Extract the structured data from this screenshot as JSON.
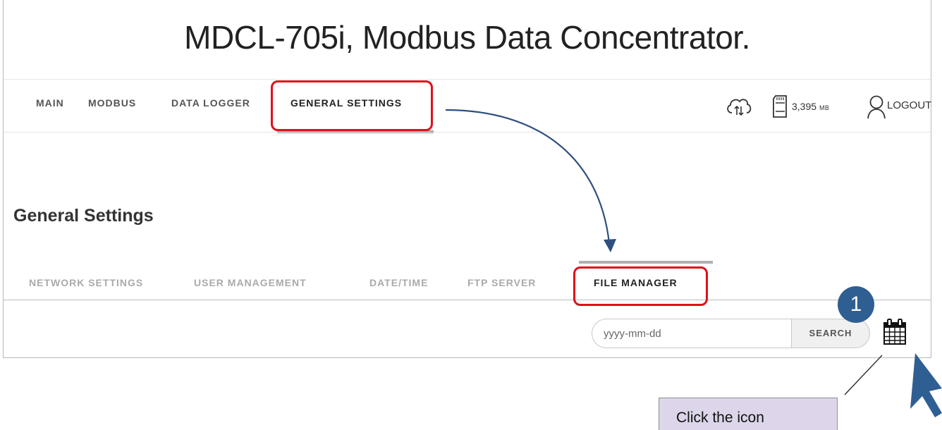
{
  "app": {
    "title": "MDCL-705i, Modbus Data Concentrator."
  },
  "nav": {
    "items": [
      {
        "label": "MAIN"
      },
      {
        "label": "MODBUS"
      },
      {
        "label": "DATA LOGGER"
      },
      {
        "label": "GENERAL SETTINGS",
        "active": true
      }
    ],
    "storage_value": "3,395",
    "storage_unit": "MB",
    "logout_label": "LOGOUT"
  },
  "page": {
    "heading": "General Settings",
    "tabs": [
      {
        "label": "NETWORK SETTINGS"
      },
      {
        "label": "USER MANAGEMENT"
      },
      {
        "label": "DATE/TIME"
      },
      {
        "label": "FTP SERVER"
      },
      {
        "label": "FILE MANAGER",
        "active": true
      }
    ],
    "search": {
      "placeholder": "yyyy-mm-dd",
      "value": "",
      "button_label": "SEARCH"
    }
  },
  "annotation": {
    "step_number": "1",
    "callout_text": "Click the icon",
    "highlight_color": "#e0101a",
    "arrow_color": "#2f4f7f"
  },
  "icons": [
    "cloud-sync-icon",
    "sd-card-icon",
    "user-icon",
    "calendar-icon",
    "mouse-cursor-icon"
  ]
}
